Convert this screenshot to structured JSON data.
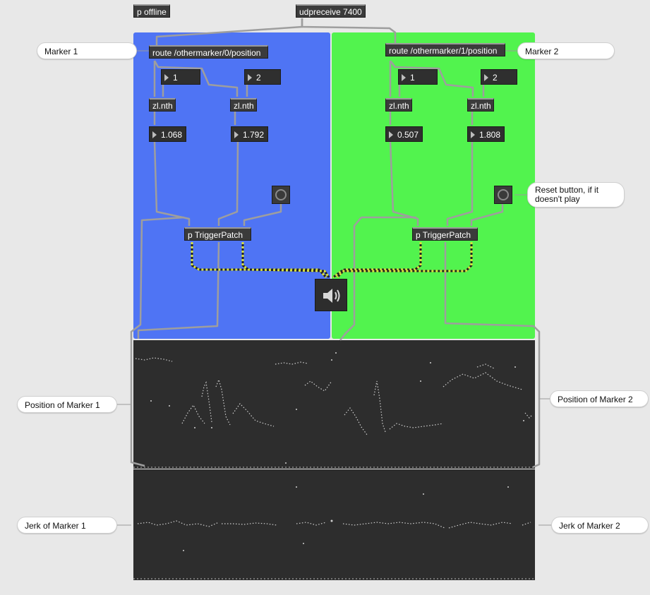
{
  "objects": {
    "p_offline": "p offline",
    "udpreceive": "udpreceive 7400",
    "route_left": "route /othermarker/0/position",
    "route_right": "route /othermarker/1/position",
    "zl_nth": "zl.nth",
    "trigger_patch": "p TriggerPatch"
  },
  "numbers": {
    "left_index1": "1",
    "left_index2": "2",
    "right_index1": "1",
    "right_index2": "2",
    "left_x": "1.068",
    "left_y": "1.792",
    "right_x": "0.507",
    "right_y": "1.808"
  },
  "comments": {
    "marker1": "Marker 1",
    "marker2": "Marker 2",
    "reset": "Reset button, if it doesn't play",
    "pos1": "Position of Marker 1",
    "pos2": "Position of Marker 2",
    "jerk1": "Jerk of Marker 1",
    "jerk2": "Jerk of Marker 2"
  },
  "icons": {
    "speaker": "speaker-icon",
    "bang": "bang-icon"
  },
  "colors": {
    "left_panel": "#4f74f4",
    "right_panel": "#52f34e",
    "scope_bg": "#2d2d2d",
    "canvas_bg": "#e8e8e8"
  }
}
